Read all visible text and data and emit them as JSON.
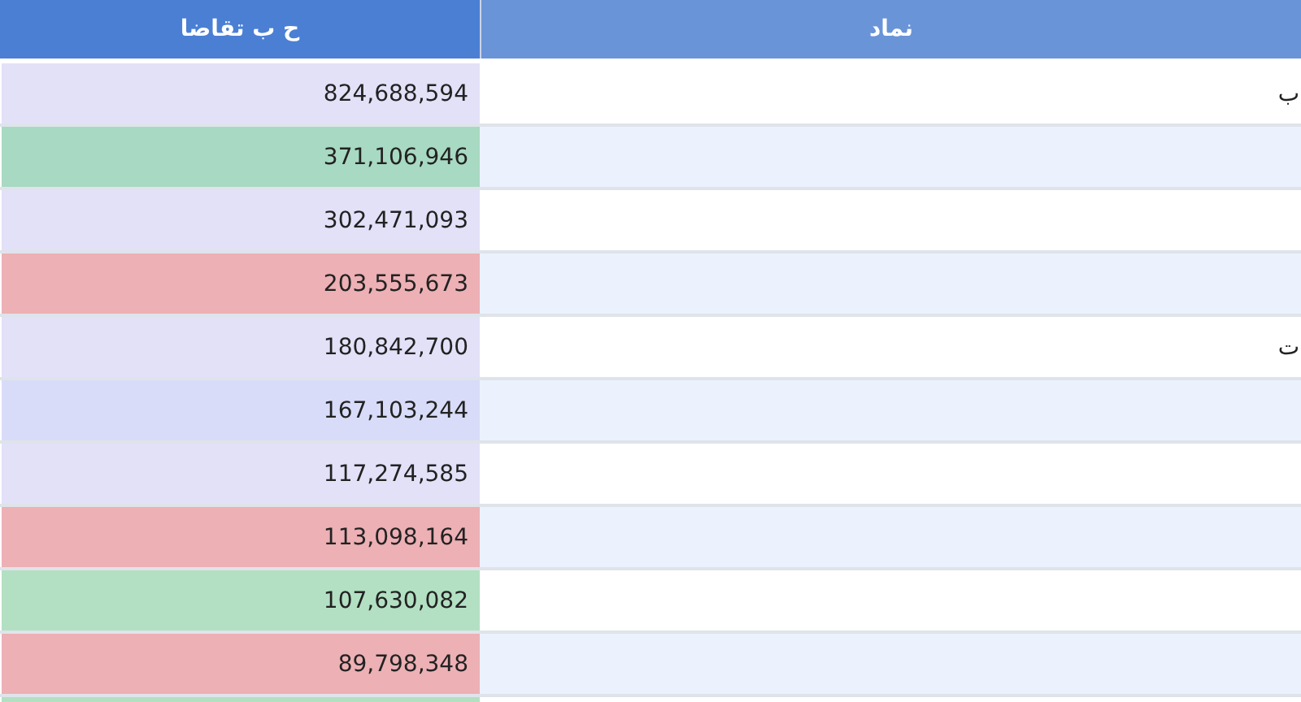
{
  "table": {
    "columns": [
      "نماد",
      "ح ب تقاضا"
    ],
    "rows": [
      {
        "symbol": "ب",
        "demand_value": "824,688,594",
        "color": "#e3e1f8"
      },
      {
        "demand_value": "371,106,946",
        "color": "#a8d9c2"
      },
      {
        "demand_value": "302,471,093",
        "color": "#e3e1f8"
      },
      {
        "demand_value": "203,555,673",
        "color": "#ecb0b5"
      },
      {
        "symbol": "ت",
        "demand_value": "180,842,700",
        "color": "#e3e1f8"
      },
      {
        "demand_value": "167,103,244",
        "color": "#d9dcf8"
      },
      {
        "demand_value": "117,274,585",
        "color": "#e3e1f8"
      },
      {
        "demand_value": "113,098,164",
        "color": "#ecb0b5"
      },
      {
        "demand_value": "107,630,082",
        "color": "#b3e0c3"
      },
      {
        "demand_value": "89,798,348",
        "color": "#ecb0b5"
      },
      {
        "color": "#b3e0c3"
      }
    ]
  }
}
